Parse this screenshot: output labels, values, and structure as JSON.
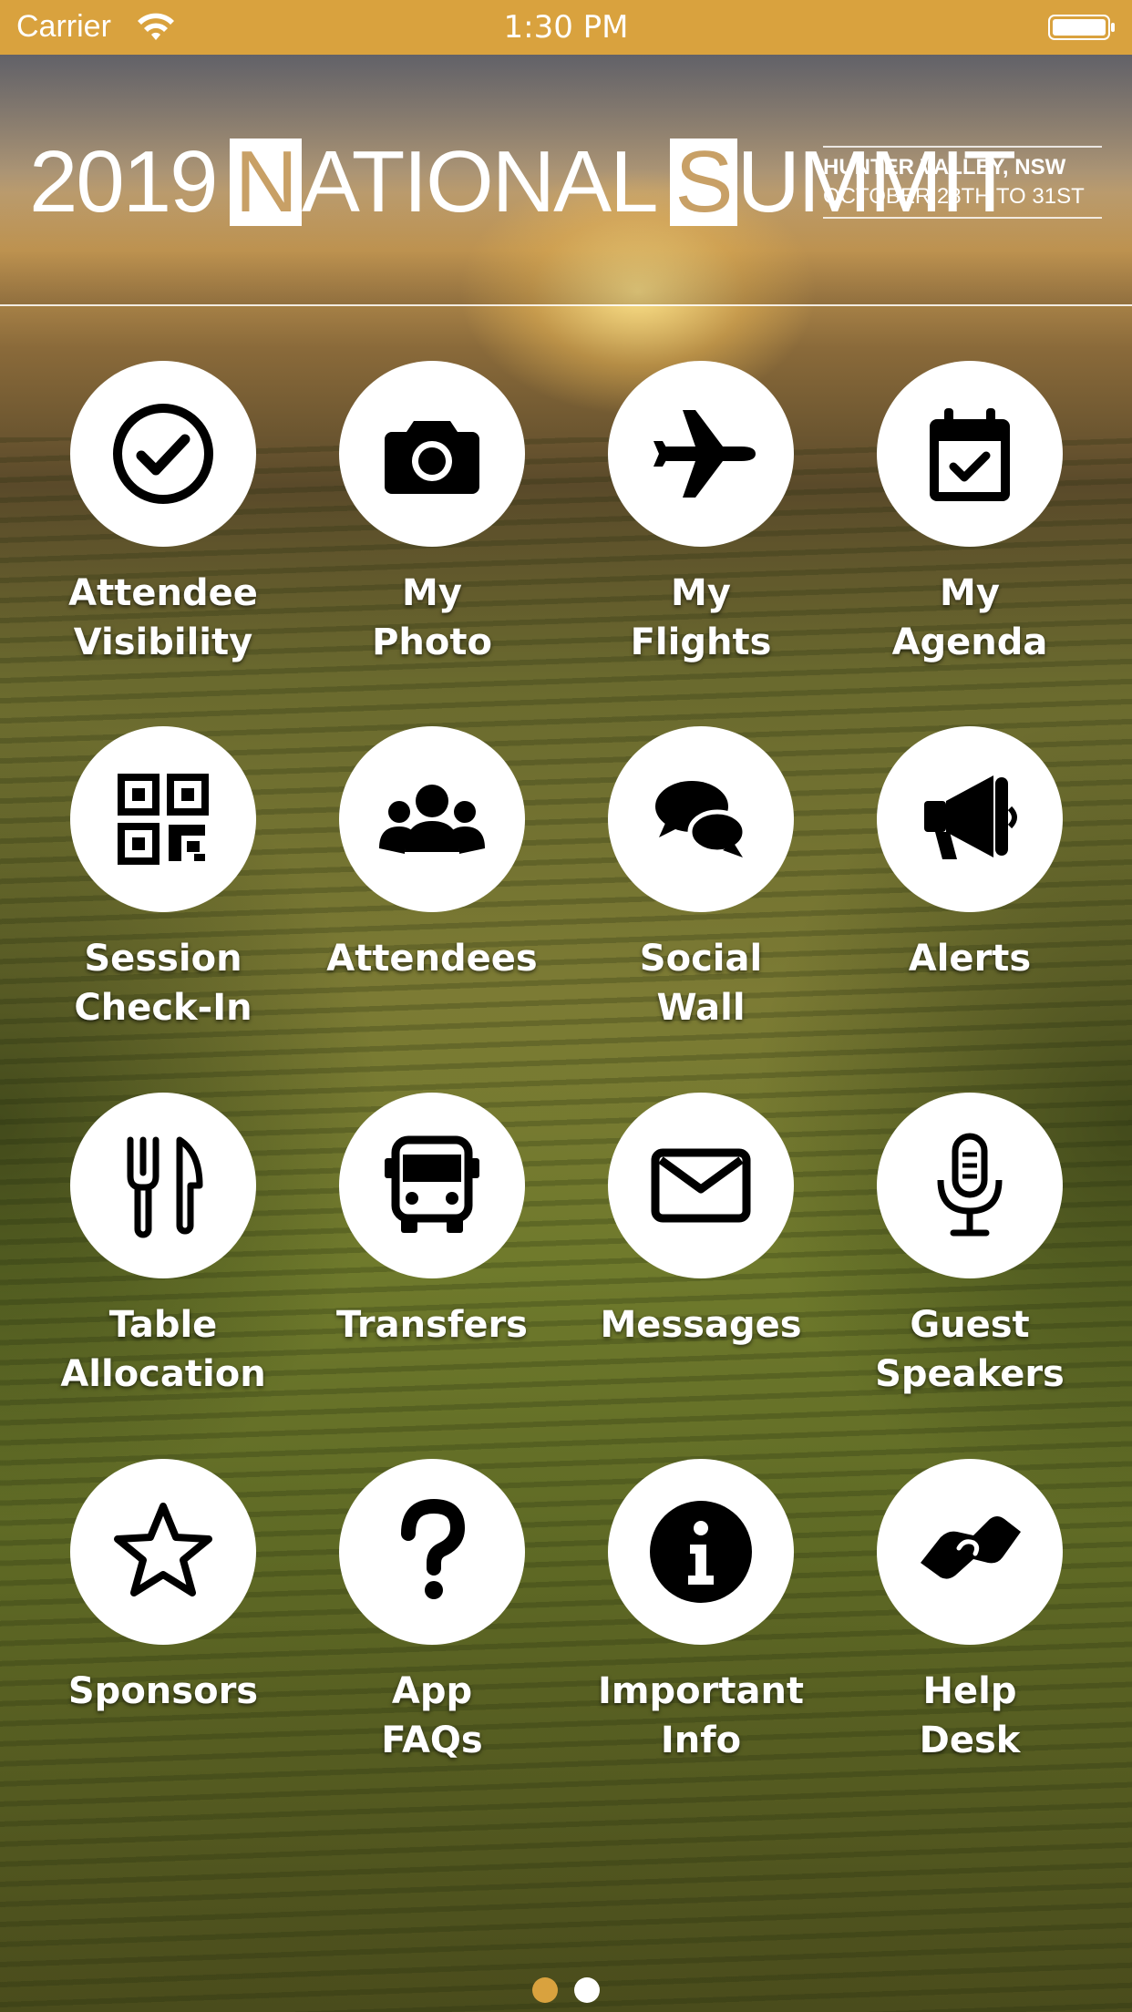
{
  "status_bar": {
    "carrier": "Carrier",
    "time": "1:30 PM"
  },
  "banner": {
    "year": "2019",
    "word1_initial": "N",
    "word1_rest": "ATIONAL",
    "word2_initial": "S",
    "word2_rest": "UMMIT",
    "location": "HUNTER VALLEY, NSW",
    "dates": "OCTOBER 28TH TO 31ST"
  },
  "tiles": [
    {
      "line1": "Attendee",
      "line2": "Visibility",
      "icon": "check-circle-icon"
    },
    {
      "line1": "My",
      "line2": "Photo",
      "icon": "camera-icon"
    },
    {
      "line1": "My",
      "line2": "Flights",
      "icon": "plane-icon"
    },
    {
      "line1": "My",
      "line2": "Agenda",
      "icon": "calendar-check-icon"
    },
    {
      "line1": "Session",
      "line2": "Check-In",
      "icon": "qr-code-icon"
    },
    {
      "line1": "Attendees",
      "line2": "",
      "icon": "users-icon"
    },
    {
      "line1": "Social",
      "line2": "Wall",
      "icon": "chat-bubbles-icon"
    },
    {
      "line1": "Alerts",
      "line2": "",
      "icon": "megaphone-icon"
    },
    {
      "line1": "Table",
      "line2": "Allocation",
      "icon": "utensils-icon"
    },
    {
      "line1": "Transfers",
      "line2": "",
      "icon": "bus-icon"
    },
    {
      "line1": "Messages",
      "line2": "",
      "icon": "envelope-icon"
    },
    {
      "line1": "Guest",
      "line2": "Speakers",
      "icon": "microphone-icon"
    },
    {
      "line1": "Sponsors",
      "line2": "",
      "icon": "star-icon"
    },
    {
      "line1": "App",
      "line2": "FAQs",
      "icon": "question-icon"
    },
    {
      "line1": "Important",
      "line2": "Info",
      "icon": "info-icon"
    },
    {
      "line1": "Help",
      "line2": "Desk",
      "icon": "handshake-icon"
    }
  ],
  "pager": {
    "current_page": 1,
    "total_pages": 2,
    "active_color": "#d9a23e",
    "inactive_color": "#ffffff"
  },
  "colors": {
    "accent": "#d9a23e"
  }
}
